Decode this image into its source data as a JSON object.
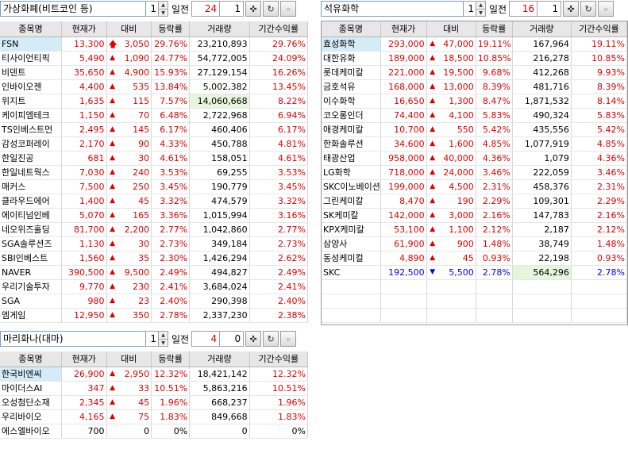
{
  "columns": [
    "종목명",
    "현재가",
    "대비",
    "등락률",
    "거래량",
    "기간수익률"
  ],
  "panels": [
    {
      "id": "crypto",
      "theme": "가상화폐(비트코인 등)",
      "period_spin": "1",
      "period_label": "일전",
      "count_a": "24",
      "count_b": "1",
      "rows": [
        {
          "name": "FSN",
          "price": "13,300",
          "dir": "limit-up",
          "change": "3,050",
          "rate": "29.76%",
          "volume": "23,210,893",
          "ret": "29.76%",
          "hl_name": true,
          "hl_vol": false
        },
        {
          "name": "티사이언티픽",
          "price": "5,490",
          "dir": "up",
          "change": "1,090",
          "rate": "24.77%",
          "volume": "54,772,005",
          "ret": "24.09%",
          "hl_name": false,
          "hl_vol": false
        },
        {
          "name": "비덴트",
          "price": "35,650",
          "dir": "up",
          "change": "4,900",
          "rate": "15.93%",
          "volume": "27,129,154",
          "ret": "16.26%",
          "hl_name": false,
          "hl_vol": false
        },
        {
          "name": "인바이오젠",
          "price": "4,400",
          "dir": "up",
          "change": "535",
          "rate": "13.84%",
          "volume": "5,002,382",
          "ret": "13.45%",
          "hl_name": false,
          "hl_vol": false
        },
        {
          "name": "위지트",
          "price": "1,635",
          "dir": "up",
          "change": "115",
          "rate": "7.57%",
          "volume": "14,060,668",
          "ret": "8.22%",
          "hl_name": false,
          "hl_vol": true
        },
        {
          "name": "케이피엠테크",
          "price": "1,150",
          "dir": "up",
          "change": "70",
          "rate": "6.48%",
          "volume": "2,722,968",
          "ret": "6.94%",
          "hl_name": false,
          "hl_vol": false
        },
        {
          "name": "TS인베스트먼",
          "price": "2,495",
          "dir": "up",
          "change": "145",
          "rate": "6.17%",
          "volume": "460,406",
          "ret": "6.17%",
          "hl_name": false,
          "hl_vol": false
        },
        {
          "name": "감성코퍼레이",
          "price": "2,170",
          "dir": "up",
          "change": "90",
          "rate": "4.33%",
          "volume": "450,788",
          "ret": "4.81%",
          "hl_name": false,
          "hl_vol": false
        },
        {
          "name": "한일진공",
          "price": "681",
          "dir": "up",
          "change": "30",
          "rate": "4.61%",
          "volume": "158,051",
          "ret": "4.61%",
          "hl_name": false,
          "hl_vol": false
        },
        {
          "name": "한일네트웍스",
          "price": "7,030",
          "dir": "up",
          "change": "240",
          "rate": "3.53%",
          "volume": "69,255",
          "ret": "3.53%",
          "hl_name": false,
          "hl_vol": false
        },
        {
          "name": "매커스",
          "price": "7,500",
          "dir": "up",
          "change": "250",
          "rate": "3.45%",
          "volume": "190,779",
          "ret": "3.45%",
          "hl_name": false,
          "hl_vol": false
        },
        {
          "name": "클라우드에어",
          "price": "1,400",
          "dir": "up",
          "change": "45",
          "rate": "3.32%",
          "volume": "474,579",
          "ret": "3.32%",
          "hl_name": false,
          "hl_vol": false
        },
        {
          "name": "에이티넘인베",
          "price": "5,070",
          "dir": "up",
          "change": "165",
          "rate": "3.36%",
          "volume": "1,015,994",
          "ret": "3.16%",
          "hl_name": false,
          "hl_vol": false
        },
        {
          "name": "네오위즈홀딩",
          "price": "81,700",
          "dir": "up",
          "change": "2,200",
          "rate": "2.77%",
          "volume": "1,042,860",
          "ret": "2.77%",
          "hl_name": false,
          "hl_vol": false
        },
        {
          "name": "SGA솔루션즈",
          "price": "1,130",
          "dir": "up",
          "change": "30",
          "rate": "2.73%",
          "volume": "349,184",
          "ret": "2.73%",
          "hl_name": false,
          "hl_vol": false
        },
        {
          "name": "SBI인베스트",
          "price": "1,560",
          "dir": "up",
          "change": "35",
          "rate": "2.30%",
          "volume": "1,426,294",
          "ret": "2.62%",
          "hl_name": false,
          "hl_vol": false
        },
        {
          "name": "NAVER",
          "price": "390,500",
          "dir": "up",
          "change": "9,500",
          "rate": "2.49%",
          "volume": "494,827",
          "ret": "2.49%",
          "hl_name": false,
          "hl_vol": false
        },
        {
          "name": "우리기술투자",
          "price": "9,770",
          "dir": "up",
          "change": "230",
          "rate": "2.41%",
          "volume": "3,684,024",
          "ret": "2.41%",
          "hl_name": false,
          "hl_vol": false
        },
        {
          "name": "SGA",
          "price": "980",
          "dir": "up",
          "change": "23",
          "rate": "2.40%",
          "volume": "290,398",
          "ret": "2.40%",
          "hl_name": false,
          "hl_vol": false
        },
        {
          "name": "엠게임",
          "price": "12,950",
          "dir": "up",
          "change": "350",
          "rate": "2.78%",
          "volume": "2,337,230",
          "ret": "2.38%",
          "hl_name": false,
          "hl_vol": false
        }
      ]
    },
    {
      "id": "petrochem",
      "theme": "석유화학",
      "period_spin": "1",
      "period_label": "일전",
      "count_a": "16",
      "count_b": "1",
      "rows": [
        {
          "name": "효성화학",
          "price": "293,000",
          "dir": "up",
          "change": "47,000",
          "rate": "19.11%",
          "volume": "167,964",
          "ret": "19.11%",
          "hl_name": true,
          "hl_vol": false
        },
        {
          "name": "대한유화",
          "price": "189,000",
          "dir": "up",
          "change": "18,500",
          "rate": "10.85%",
          "volume": "216,278",
          "ret": "10.85%",
          "hl_name": false,
          "hl_vol": false
        },
        {
          "name": "롯데케미칼",
          "price": "221,000",
          "dir": "up",
          "change": "19,500",
          "rate": "9.68%",
          "volume": "412,268",
          "ret": "9.93%",
          "hl_name": false,
          "hl_vol": false
        },
        {
          "name": "금호석유",
          "price": "168,000",
          "dir": "up",
          "change": "13,000",
          "rate": "8.39%",
          "volume": "481,716",
          "ret": "8.39%",
          "hl_name": false,
          "hl_vol": false
        },
        {
          "name": "이수화학",
          "price": "16,650",
          "dir": "up",
          "change": "1,300",
          "rate": "8.47%",
          "volume": "1,871,532",
          "ret": "8.14%",
          "hl_name": false,
          "hl_vol": false
        },
        {
          "name": "코오롱인더",
          "price": "74,400",
          "dir": "up",
          "change": "4,100",
          "rate": "5.83%",
          "volume": "490,324",
          "ret": "5.83%",
          "hl_name": false,
          "hl_vol": false
        },
        {
          "name": "애경케미칼",
          "price": "10,700",
          "dir": "up",
          "change": "550",
          "rate": "5.42%",
          "volume": "435,556",
          "ret": "5.42%",
          "hl_name": false,
          "hl_vol": false
        },
        {
          "name": "한화솔루션",
          "price": "34,600",
          "dir": "up",
          "change": "1,600",
          "rate": "4.85%",
          "volume": "1,077,919",
          "ret": "4.85%",
          "hl_name": false,
          "hl_vol": false
        },
        {
          "name": "태광산업",
          "price": "958,000",
          "dir": "up",
          "change": "40,000",
          "rate": "4.36%",
          "volume": "1,079",
          "ret": "4.36%",
          "hl_name": false,
          "hl_vol": false
        },
        {
          "name": "LG화학",
          "price": "718,000",
          "dir": "up",
          "change": "24,000",
          "rate": "3.46%",
          "volume": "222,059",
          "ret": "3.46%",
          "hl_name": false,
          "hl_vol": false
        },
        {
          "name": "SKC이노베이션",
          "price": "199,000",
          "dir": "up",
          "change": "4,500",
          "rate": "2.31%",
          "volume": "458,376",
          "ret": "2.31%",
          "hl_name": false,
          "hl_vol": false
        },
        {
          "name": "그린케미칼",
          "price": "8,470",
          "dir": "up",
          "change": "190",
          "rate": "2.29%",
          "volume": "109,301",
          "ret": "2.29%",
          "hl_name": false,
          "hl_vol": false
        },
        {
          "name": "SK케미칼",
          "price": "142,000",
          "dir": "up",
          "change": "3,000",
          "rate": "2.16%",
          "volume": "147,783",
          "ret": "2.16%",
          "hl_name": false,
          "hl_vol": false
        },
        {
          "name": "KPX케미칼",
          "price": "53,100",
          "dir": "up",
          "change": "1,100",
          "rate": "2.12%",
          "volume": "2,187",
          "ret": "2.12%",
          "hl_name": false,
          "hl_vol": false
        },
        {
          "name": "삼양사",
          "price": "61,900",
          "dir": "up",
          "change": "900",
          "rate": "1.48%",
          "volume": "38,749",
          "ret": "1.48%",
          "hl_name": false,
          "hl_vol": false
        },
        {
          "name": "동성케미컬",
          "price": "4,890",
          "dir": "up",
          "change": "45",
          "rate": "0.93%",
          "volume": "22,198",
          "ret": "0.93%",
          "hl_name": false,
          "hl_vol": false
        },
        {
          "name": "SKC",
          "price": "192,500",
          "dir": "down",
          "change": "5,500",
          "rate": "2.78%",
          "volume": "564,296",
          "ret": "2.78%",
          "hl_name": false,
          "hl_vol": true
        }
      ]
    },
    {
      "id": "cannabis",
      "theme": "마리화나(대마)",
      "period_spin": "1",
      "period_label": "일전",
      "count_a": "4",
      "count_b": "0",
      "rows": [
        {
          "name": "한국비엔씨",
          "price": "26,900",
          "dir": "up",
          "change": "2,950",
          "rate": "12.32%",
          "volume": "18,421,142",
          "ret": "12.32%",
          "hl_name": true,
          "hl_vol": false
        },
        {
          "name": "마이더스AI",
          "price": "347",
          "dir": "up",
          "change": "33",
          "rate": "10.51%",
          "volume": "5,863,216",
          "ret": "10.51%",
          "hl_name": false,
          "hl_vol": false
        },
        {
          "name": "오성첨단소재",
          "price": "2,345",
          "dir": "up",
          "change": "45",
          "rate": "1.96%",
          "volume": "668,237",
          "ret": "1.96%",
          "hl_name": false,
          "hl_vol": false
        },
        {
          "name": "우리바이오",
          "price": "4,165",
          "dir": "up",
          "change": "75",
          "rate": "1.83%",
          "volume": "849,668",
          "ret": "1.83%",
          "hl_name": false,
          "hl_vol": false
        },
        {
          "name": "에스엘바이오",
          "price": "700",
          "dir": "none",
          "change": "0",
          "rate": "0%",
          "volume": "0",
          "ret": "0%",
          "hl_name": false,
          "hl_vol": false
        }
      ]
    }
  ],
  "icons": {
    "pin": "pin-icon",
    "refresh": "refresh-icon",
    "next": "double-chevron-right-icon",
    "spin_up": "triangle-up-icon",
    "spin_down": "triangle-down-icon"
  },
  "colors": {
    "up": "#e00000",
    "down": "#0000ff",
    "highlight": "#d4ecf7",
    "volume_highlight": "#e6f6dd",
    "header": "#e7e7e7"
  }
}
